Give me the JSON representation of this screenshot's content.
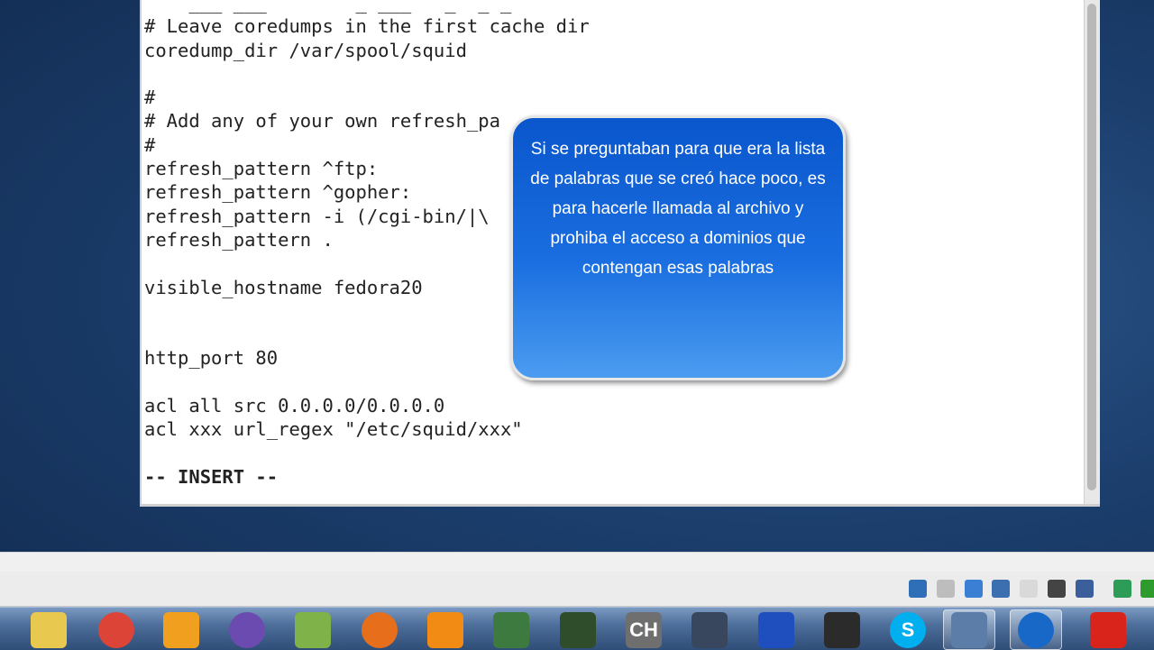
{
  "terminal": {
    "lines": [
      "    ___ ___        _ ___   _  _ _",
      "# Leave coredumps in the first cache dir",
      "coredump_dir /var/spool/squid",
      "",
      "#",
      "# Add any of your own refresh_pa",
      "#",
      "refresh_pattern ^ftp:",
      "refresh_pattern ^gopher:",
      "refresh_pattern -i (/cgi-bin/|\\",
      "refresh_pattern .",
      "",
      "visible_hostname fedora20",
      "",
      "",
      "http_port 80",
      "",
      "acl all src 0.0.0.0/0.0.0.0",
      "acl xxx url_regex \"/etc/squid/xxx\"",
      ""
    ],
    "mode_line": "-- INSERT --"
  },
  "tooltip": {
    "text": "Si se preguntaban para que era la lista de palabras que se creó hace poco, es para hacerle llamada al archivo y prohiba  el acceso a dominios que contengan esas palabras"
  },
  "status_icons": [
    "hard-disk-icon",
    "optical-drive-icon",
    "usb-pen-icon",
    "network-icon",
    "shared-folder-icon",
    "video-capture-icon",
    "virtualbox-icon",
    "globe-icon",
    "download-icon"
  ],
  "taskbar": {
    "apps": [
      {
        "name": "folder-icon",
        "color": "#e9c84f"
      },
      {
        "name": "chrome-icon",
        "color": "#db4437"
      },
      {
        "name": "java-config-icon",
        "color": "#f0a01e"
      },
      {
        "name": "bittorrent-icon",
        "color": "#6b4bb0"
      },
      {
        "name": "notepad-plus-icon",
        "color": "#7fb349"
      },
      {
        "name": "firefox-icon",
        "color": "#e76f1b"
      },
      {
        "name": "vlc-icon",
        "color": "#f28b13"
      },
      {
        "name": "chrome-app-icon",
        "color": "#3c7a3f"
      },
      {
        "name": "game-icon",
        "color": "#2f4c2b"
      },
      {
        "name": "ch-app-icon",
        "color": "#6f6f6f",
        "label": "CH"
      },
      {
        "name": "game-launcher-icon",
        "color": "#38475e"
      },
      {
        "name": "sonic-icon",
        "color": "#1f4fbf"
      },
      {
        "name": "satellite-icon",
        "color": "#2b2b2b"
      },
      {
        "name": "skype-icon",
        "color": "#00aff0",
        "label": "S"
      },
      {
        "name": "virtualbox-app-icon",
        "color": "#5b7da8",
        "active": true
      },
      {
        "name": "network-app-icon",
        "color": "#1868c8",
        "active": true
      },
      {
        "name": "pdf-reader-icon",
        "color": "#d8241b"
      }
    ]
  }
}
